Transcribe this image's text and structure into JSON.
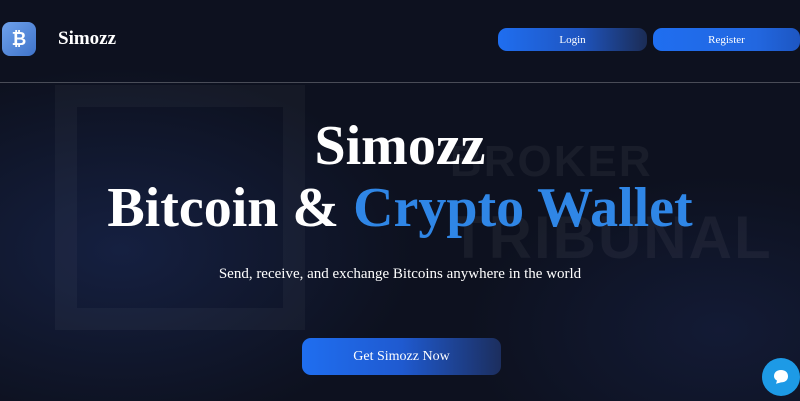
{
  "header": {
    "brand": "Simozz",
    "logo_icon": "bitcoin-icon",
    "login_label": "Login",
    "register_label": "Register"
  },
  "hero": {
    "title_line1": "Simozz",
    "title_line2_part1": "Bitcoin & ",
    "title_line2_accent": "Crypto Wallet",
    "subtitle": "Send, receive, and exchange Bitcoins anywhere in the world",
    "cta_label": "Get Simozz Now"
  },
  "watermark": {
    "line1": "BROKER",
    "line2": "TRIBUNAL"
  },
  "chat": {
    "icon": "chat-bubble-icon"
  },
  "colors": {
    "background": "#0d111f",
    "accent": "#2f86e6",
    "button": "#1f6ef0",
    "chat": "#1d9ae6"
  }
}
